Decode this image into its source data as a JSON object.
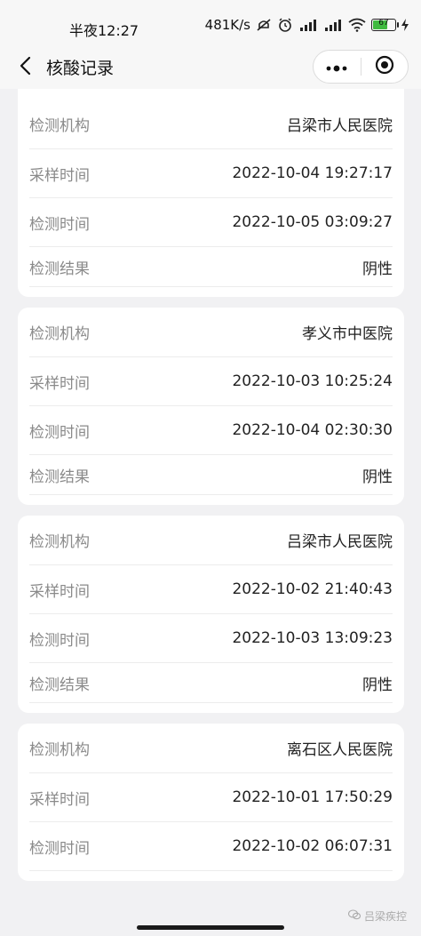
{
  "status_bar": {
    "time": "半夜12:27",
    "network_speed": "481K/s",
    "battery_level": "67"
  },
  "nav": {
    "title": "核酸记录"
  },
  "records": [
    {
      "fields": [
        {
          "label": "检测机构",
          "value": "吕梁市人民医院"
        },
        {
          "label": "采样时间",
          "value": "2022-10-04 19:27:17"
        },
        {
          "label": "检测时间",
          "value": "2022-10-05 03:09:27"
        },
        {
          "label": "检测结果",
          "value": "阴性"
        }
      ]
    },
    {
      "fields": [
        {
          "label": "检测机构",
          "value": "孝义市中医院"
        },
        {
          "label": "采样时间",
          "value": "2022-10-03 10:25:24"
        },
        {
          "label": "检测时间",
          "value": "2022-10-04 02:30:30"
        },
        {
          "label": "检测结果",
          "value": "阴性"
        }
      ]
    },
    {
      "fields": [
        {
          "label": "检测机构",
          "value": "吕梁市人民医院"
        },
        {
          "label": "采样时间",
          "value": "2022-10-02 21:40:43"
        },
        {
          "label": "检测时间",
          "value": "2022-10-03 13:09:23"
        },
        {
          "label": "检测结果",
          "value": "阴性"
        }
      ]
    },
    {
      "fields": [
        {
          "label": "检测机构",
          "value": "离石区人民医院"
        },
        {
          "label": "采样时间",
          "value": "2022-10-01 17:50:29"
        },
        {
          "label": "检测时间",
          "value": "2022-10-02 06:07:31"
        }
      ]
    }
  ],
  "watermark": {
    "text": "吕梁疾控"
  },
  "icons": {
    "back": "chevron-left-icon",
    "more": "more-dots-icon",
    "close": "target-circle-icon"
  }
}
